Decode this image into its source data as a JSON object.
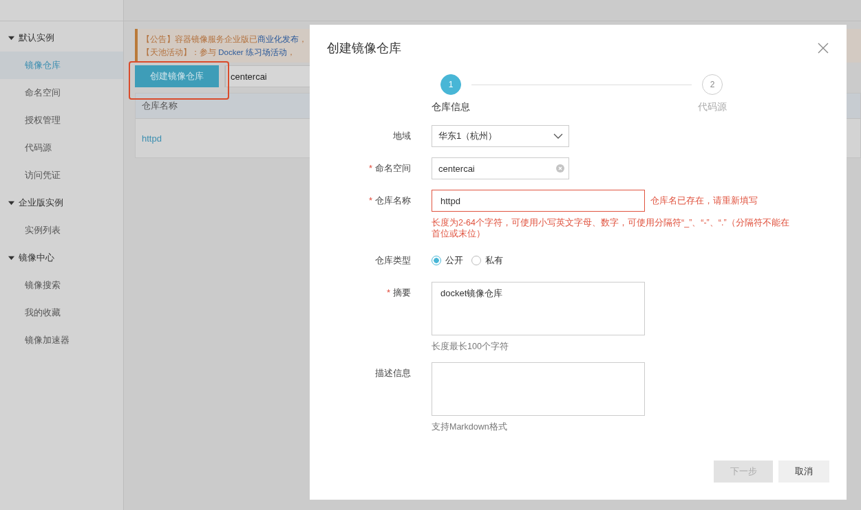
{
  "sidebar": {
    "groups": [
      {
        "label": "默认实例",
        "expanded": true,
        "children": [
          {
            "label": "镜像仓库",
            "selected": true
          },
          {
            "label": "命名空间",
            "selected": false
          },
          {
            "label": "授权管理",
            "selected": false
          },
          {
            "label": "代码源",
            "selected": false
          },
          {
            "label": "访问凭证",
            "selected": false
          }
        ]
      },
      {
        "label": "企业版实例",
        "expanded": true,
        "children": [
          {
            "label": "实例列表",
            "selected": false
          }
        ]
      },
      {
        "label": "镜像中心",
        "expanded": true,
        "children": [
          {
            "label": "镜像搜索",
            "selected": false
          },
          {
            "label": "我的收藏",
            "selected": false
          },
          {
            "label": "镜像加速器",
            "selected": false
          }
        ]
      }
    ]
  },
  "notice": {
    "lines": [
      [
        {
          "kind": "text",
          "text": "【公告】容器镜像服务企业版已"
        },
        {
          "kind": "link",
          "text": "商业化发布"
        },
        {
          "kind": "text",
          "text": "，"
        }
      ],
      [
        {
          "kind": "text",
          "text": "【天池活动】：参与 "
        },
        {
          "kind": "link",
          "text": "Docker 练习场活动"
        },
        {
          "kind": "text",
          "text": "，"
        }
      ]
    ]
  },
  "toolbar": {
    "create_button": "创建镜像仓库",
    "highlighted": true,
    "search_value": "centercai"
  },
  "table": {
    "columns": [
      "仓库名称"
    ],
    "rows": [
      [
        "httpd"
      ]
    ]
  },
  "dialog": {
    "title": "创建镜像仓库",
    "steps": [
      {
        "number": "1",
        "label": "仓库信息",
        "selected": true
      },
      {
        "number": "2",
        "label": "代码源",
        "selected": false
      }
    ],
    "fields": [
      {
        "kind": "select",
        "label": "地域",
        "value": "华东1（杭州）"
      },
      {
        "kind": "input",
        "label": "命名空间",
        "required_mark": "*",
        "value": "centercai",
        "clearable": true
      },
      {
        "kind": "input",
        "label": "仓库名称",
        "required_mark": "*",
        "value": "httpd",
        "invalid": true,
        "error": "仓库名已存在，请重新填写",
        "hint": "长度为2-64个字符，可使用小写英文字母、数字，可使用分隔符“_”、“-”、“.”（分隔符不能在首位或末位）"
      },
      {
        "kind": "radio",
        "label": "仓库类型",
        "options": [
          {
            "label": "公开",
            "selected": true
          },
          {
            "label": "私有",
            "selected": false
          }
        ]
      },
      {
        "kind": "textarea",
        "label": "摘要",
        "required_mark": "*",
        "value": "docket镜像仓库",
        "hint": "长度最长100个字符"
      },
      {
        "kind": "textarea",
        "label": "描述信息",
        "hint": "支持Markdown格式"
      }
    ],
    "buttons": [
      {
        "label": "下一步",
        "kind": "primary",
        "disabled": true
      },
      {
        "label": "取消",
        "kind": "secondary",
        "disabled": false
      }
    ]
  }
}
